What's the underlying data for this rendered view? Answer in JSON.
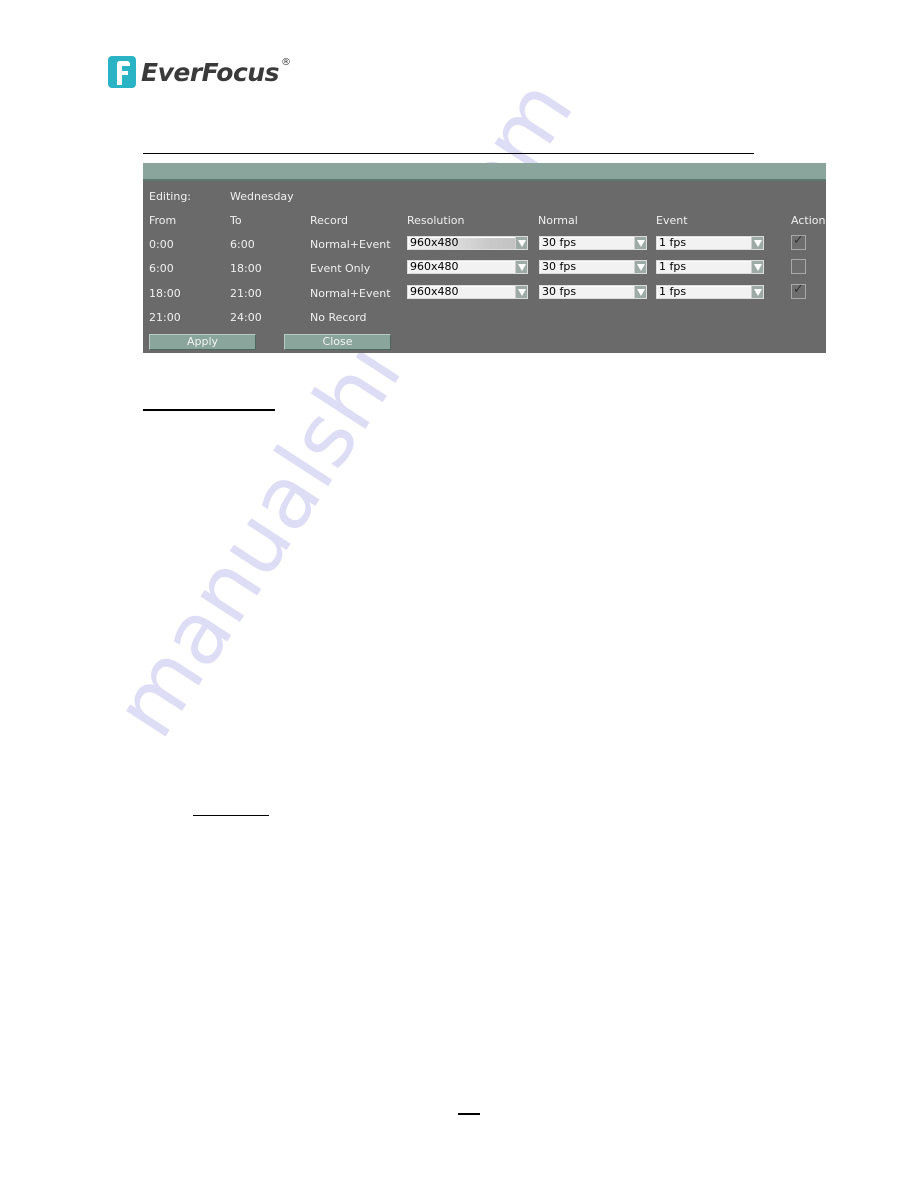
{
  "logo": {
    "brand": "EverFocus",
    "registered_mark": "®",
    "brand_color": "#2ab3c5"
  },
  "panel": {
    "editing_label": "Editing:",
    "editing_day": "Wednesday",
    "headers": {
      "from": "From",
      "to": "To",
      "record": "Record",
      "resolution": "Resolution",
      "normal": "Normal",
      "event": "Event",
      "action": "Action"
    },
    "rows": [
      {
        "from": "0:00",
        "to": "6:00",
        "record": "Normal+Event",
        "resolution": "960x480",
        "normal": "30  fps",
        "event": "1  fps",
        "action_checked": true,
        "action_mark": "✓"
      },
      {
        "from": "6:00",
        "to": "18:00",
        "record": "Event  Only",
        "resolution": "960x480",
        "normal": "30  fps",
        "event": "1  fps",
        "action_checked": false,
        "action_mark": ""
      },
      {
        "from": "18:00",
        "to": "21:00",
        "record": "Normal+Event",
        "resolution": "960x480",
        "normal": "30  fps",
        "event": "1  fps",
        "action_checked": true,
        "action_mark": "✓"
      },
      {
        "from": "21:00",
        "to": "24:00",
        "record": "No  Record"
      }
    ],
    "buttons": {
      "apply": "Apply",
      "close": "Close"
    },
    "colors": {
      "panel_bg": "#6a6a6a",
      "titlebar": "#8aa59c",
      "text": "#f0f0f0"
    }
  },
  "watermark": "manualshive.com"
}
